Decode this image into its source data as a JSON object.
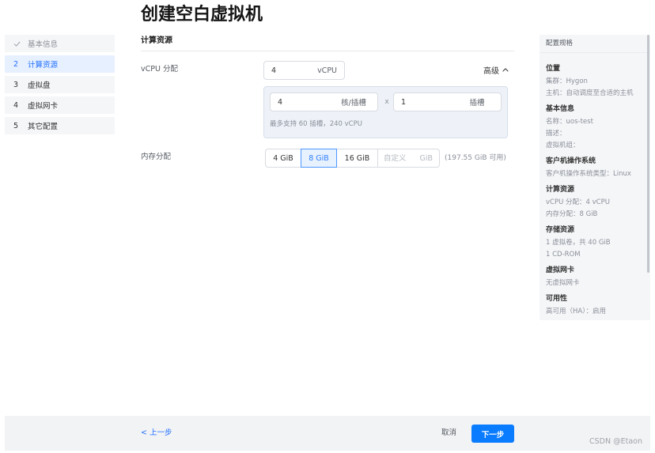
{
  "page": {
    "title": "创建空白虚拟机"
  },
  "steps": [
    {
      "icon": "check-icon",
      "label": "基本信息",
      "done": true
    },
    {
      "number": "2",
      "label": "计算资源",
      "current": true
    },
    {
      "number": "3",
      "label": "虚拟盘"
    },
    {
      "number": "4",
      "label": "虚拟网卡"
    },
    {
      "number": "5",
      "label": "其它配置"
    }
  ],
  "compute": {
    "section_title": "计算资源",
    "vcpu": {
      "label": "vCPU 分配",
      "value": "4",
      "unit": "vCPU",
      "advanced_label": "高级",
      "advanced_icon": "chevron-up-icon",
      "advanced_expanded": true,
      "cores_per_socket": {
        "value": "4",
        "unit": "核/插槽"
      },
      "multiply_sign": "x",
      "sockets": {
        "value": "1",
        "unit": "插槽"
      },
      "hint": "最多支持 60 插槽，240 vCPU"
    },
    "memory": {
      "label": "内存分配",
      "options": [
        {
          "label": "4 GiB",
          "selected": false
        },
        {
          "label": "8 GiB",
          "selected": true
        },
        {
          "label": "16 GiB",
          "selected": false
        }
      ],
      "custom": {
        "value": "",
        "placeholder": "自定义",
        "unit": "GiB"
      },
      "available": "(197.55 GiB 可用)"
    }
  },
  "summary": {
    "title": "配置规格",
    "groups": [
      {
        "heading": "位置",
        "lines": [
          "集群：Hygon",
          "主机：自动调度至合适的主机"
        ]
      },
      {
        "heading": "基本信息",
        "lines": [
          "名称：uos-test",
          "描述：",
          "虚拟机组："
        ]
      },
      {
        "heading": "客户机操作系统",
        "lines": [
          "客户机操作系统类型：Linux"
        ]
      },
      {
        "heading": "计算资源",
        "lines": [
          "vCPU 分配：4 vCPU",
          "内存分配：8 GiB"
        ]
      },
      {
        "heading": "存储资源",
        "lines": [
          "1 虚拟卷，共 40 GiB",
          "1 CD-ROM"
        ]
      },
      {
        "heading": "虚拟网卡",
        "lines": [
          "无虚拟网卡"
        ]
      },
      {
        "heading": "可用性",
        "lines": [
          "高可用（HA）：启用"
        ]
      }
    ]
  },
  "footer": {
    "prev_label": "< 上一步",
    "cancel_label": "取消",
    "next_label": "下一步"
  },
  "watermark": "CSDN @Etaon",
  "colors": {
    "accent": "#1f6fff",
    "primary": "#0a7cff"
  }
}
